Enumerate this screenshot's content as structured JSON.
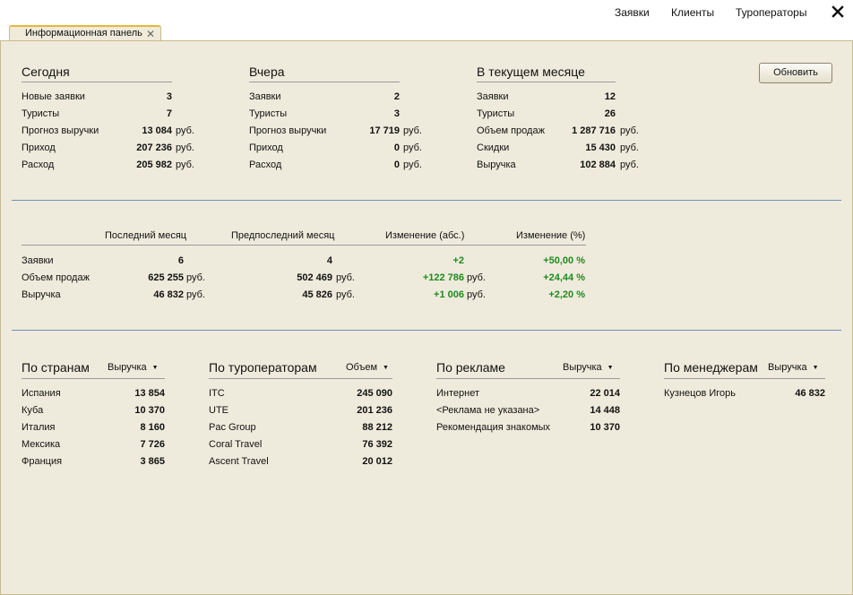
{
  "menu": {
    "items": [
      "Заявки",
      "Клиенты",
      "Туроператоры"
    ]
  },
  "tab": {
    "label": "Информационная панель",
    "close_glyph": "✕"
  },
  "refresh_label": "Обновить",
  "currency": "руб.",
  "today": {
    "title": "Сегодня",
    "rows": [
      {
        "label": "Новые заявки",
        "value": "3",
        "unit": ""
      },
      {
        "label": "Туристы",
        "value": "7",
        "unit": ""
      },
      {
        "label": "Прогноз выручки",
        "value": "13 084",
        "unit": "руб."
      },
      {
        "label": "Приход",
        "value": "207 236",
        "unit": "руб."
      },
      {
        "label": "Расход",
        "value": "205 982",
        "unit": "руб."
      }
    ]
  },
  "yesterday": {
    "title": "Вчера",
    "rows": [
      {
        "label": "Заявки",
        "value": "2",
        "unit": ""
      },
      {
        "label": "Туристы",
        "value": "3",
        "unit": ""
      },
      {
        "label": "Прогноз выручки",
        "value": "17 719",
        "unit": "руб."
      },
      {
        "label": "Приход",
        "value": "0",
        "unit": "руб."
      },
      {
        "label": "Расход",
        "value": "0",
        "unit": "руб."
      }
    ]
  },
  "month": {
    "title": "В текущем месяце",
    "rows": [
      {
        "label": "Заявки",
        "value": "12",
        "unit": ""
      },
      {
        "label": "Туристы",
        "value": "26",
        "unit": ""
      },
      {
        "label": "Объем продаж",
        "value": "1 287 716",
        "unit": "руб."
      },
      {
        "label": "Скидки",
        "value": "15 430",
        "unit": "руб."
      },
      {
        "label": "Выручка",
        "value": "102 884",
        "unit": "руб."
      }
    ]
  },
  "compare": {
    "headers": [
      "Последний месяц",
      "Предпоследний месяц",
      "Изменение (абс.)",
      "Изменение (%)"
    ],
    "rows": [
      {
        "label": "Заявки",
        "last": "6",
        "last_unit": "",
        "prev": "4",
        "prev_unit": "",
        "abs": "+2",
        "abs_unit": "",
        "pct": "+50,00 %"
      },
      {
        "label": "Объем продаж",
        "last": "625 255",
        "last_unit": "руб.",
        "prev": "502 469",
        "prev_unit": "руб.",
        "abs": "+122 786",
        "abs_unit": "руб.",
        "pct": "+24,44 %"
      },
      {
        "label": "Выручка",
        "last": "46 832",
        "last_unit": "руб.",
        "prev": "45 826",
        "prev_unit": "руб.",
        "abs": "+1 006",
        "abs_unit": "руб.",
        "pct": "+2,20 %"
      }
    ],
    "positive_color": "#1f8a1f"
  },
  "by_country": {
    "title": "По странам",
    "dropdown": "Выручка",
    "rows": [
      {
        "label": "Испания",
        "value": "13 854"
      },
      {
        "label": "Куба",
        "value": "10 370"
      },
      {
        "label": "Италия",
        "value": "8 160"
      },
      {
        "label": "Мексика",
        "value": "7 726"
      },
      {
        "label": "Франция",
        "value": "3 865"
      }
    ]
  },
  "by_operator": {
    "title": "По туроператорам",
    "dropdown": "Объем",
    "rows": [
      {
        "label": "ITC",
        "value": "245 090"
      },
      {
        "label": "UTE",
        "value": "201 236"
      },
      {
        "label": "Pac Group",
        "value": "88 212"
      },
      {
        "label": "Coral Travel",
        "value": "76 392"
      },
      {
        "label": "Ascent Travel",
        "value": "20 012"
      }
    ]
  },
  "by_ads": {
    "title": "По рекламе",
    "dropdown": "Выручка",
    "rows": [
      {
        "label": "Интернет",
        "value": "22 014"
      },
      {
        "label": "<Реклама не указана>",
        "value": "14 448"
      },
      {
        "label": "Рекомендация знакомых",
        "value": "10 370"
      }
    ]
  },
  "by_manager": {
    "title": "По менеджерам",
    "dropdown": "Выручка",
    "rows": [
      {
        "label": "Кузнецов Игорь",
        "value": "46 832"
      }
    ]
  }
}
